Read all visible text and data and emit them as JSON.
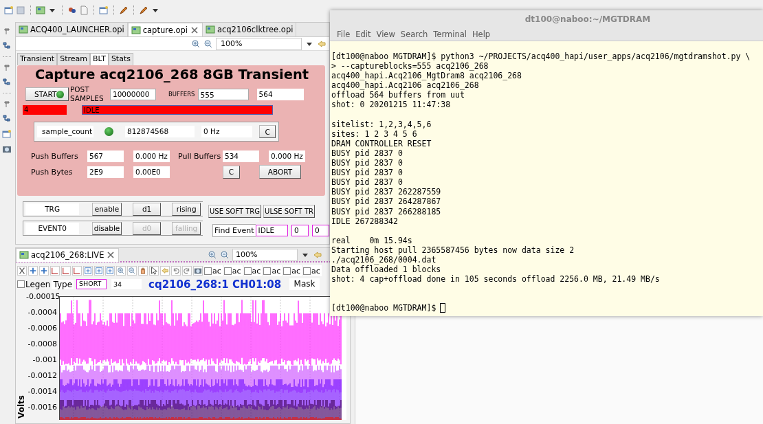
{
  "editor": {
    "tabs": [
      {
        "label": "ACQ400_LAUNCHER.opi",
        "selected": false,
        "closable": false
      },
      {
        "label": "capture.opi",
        "selected": true,
        "closable": true
      },
      {
        "label": "acq2106clktree.opi",
        "selected": false,
        "closable": false
      }
    ],
    "zoom": "100%"
  },
  "capture": {
    "tabs": [
      {
        "label": "Transient",
        "selected": false
      },
      {
        "label": "Stream",
        "selected": false
      },
      {
        "label": "BLT",
        "selected": true
      },
      {
        "label": "Stats",
        "selected": false
      }
    ],
    "title": "Capture acq2106_268 8GB Transient",
    "start": {
      "label": "START",
      "led_on": true
    },
    "post_samples_label": "POST SAMPLES",
    "post_samples": "10000000",
    "buffers_label": "BUFFERS",
    "buffers": "555",
    "buffers_total": "564",
    "status_code": {
      "text": "4",
      "alarm": true
    },
    "state": {
      "text": "IDLE",
      "alarm": true
    },
    "sample_count": {
      "label": "sample_count",
      "led_on": true,
      "value": "812874568",
      "rate": "0 Hz",
      "button": "C"
    },
    "push_buffers": {
      "label": "Push Buffers",
      "value": "567",
      "rate": "0.000 Hz"
    },
    "pull_buffers": {
      "label": "Pull Buffers",
      "value": "534",
      "rate": "0.000 Hz"
    },
    "push_bytes": {
      "label": "Push Bytes",
      "value": "2E9",
      "rate": "0.00E0"
    },
    "clear_button": "C",
    "abort_button": "ABORT"
  },
  "triggers": {
    "rows": [
      {
        "name": "TRG",
        "buttons": [
          {
            "label": "enable",
            "disabled": false
          },
          {
            "label": "d1",
            "disabled": false
          },
          {
            "label": "rising",
            "disabled": false
          }
        ]
      },
      {
        "name": "EVENT0",
        "buttons": [
          {
            "label": "disable",
            "disabled": false
          },
          {
            "label": "d0",
            "disabled": true
          },
          {
            "label": "falling",
            "disabled": true
          }
        ]
      }
    ],
    "soft_buttons": [
      "USE SOFT TRG",
      "ULSE SOFT TR"
    ],
    "find_event": {
      "label": "Find Event",
      "fields": [
        "IDLE",
        "0",
        "0"
      ]
    }
  },
  "live": {
    "tab": "acq2106_268:LIVE",
    "zoom": "100%",
    "channel_checks": [
      {
        "label": "ac",
        "checked": false
      },
      {
        "label": "ac",
        "checked": false
      },
      {
        "label": "ac",
        "checked": false
      },
      {
        "label": "ac",
        "checked": false
      },
      {
        "label": "ac",
        "checked": false
      },
      {
        "label": "ac",
        "checked": false
      }
    ],
    "legend": {
      "label": "Legen",
      "checked": false
    },
    "type_label": "Type",
    "type": "SHORT",
    "count": "34",
    "title": "cq2106_268:1 CH01:08",
    "mask": "Mask",
    "ylabel": "Volts",
    "yticks": [
      "-0.00015",
      "-0.0004",
      "-0.0006",
      "-0.0008",
      "-0.001",
      "-0.0012",
      "-0.0014",
      "-0.0016"
    ]
  },
  "terminal": {
    "title": "dt100@naboo:~/MGTDRAM",
    "menu": [
      "File",
      "Edit",
      "View",
      "Search",
      "Terminal",
      "Help"
    ],
    "blocks": [
      [
        "[dt100@naboo MGTDRAM]$ python3 ~/PROJECTS/acq400_hapi/user_apps/acq2106/mgtdramshot.py \\",
        "> --captureblocks=555 acq2106_268",
        "acq400_hapi.Acq2106_MgtDram8 acq2106_268",
        "acq400_hapi.Acq2106 acq2106_268",
        "offload 564 buffers from uut",
        "shot: 0 20201215 11:47:38"
      ],
      [
        "sitelist: 1,2,3,4,5,6",
        "sites: 1 2 3 4 5 6",
        "DRAM CONTROLLER RESET",
        "BUSY pid 2837 0",
        "BUSY pid 2837 0",
        "BUSY pid 2837 0",
        "BUSY pid 2837 0",
        "BUSY pid 2837 262287559",
        "BUSY pid 2837 264287867",
        "BUSY pid 2837 266288185",
        "IDLE 267288342"
      ],
      [
        "real    0m 15.94s",
        "Starting host pull 2365587456 bytes now data size 2",
        "./acq2106_268/0004.dat",
        "Data offloaded 1 blocks",
        "shot: 4 cap+offload done in 105 seconds offload 2256.0 MB, 21.49 MB/s"
      ]
    ],
    "prompt": "[dt100@naboo MGTDRAM]$"
  }
}
